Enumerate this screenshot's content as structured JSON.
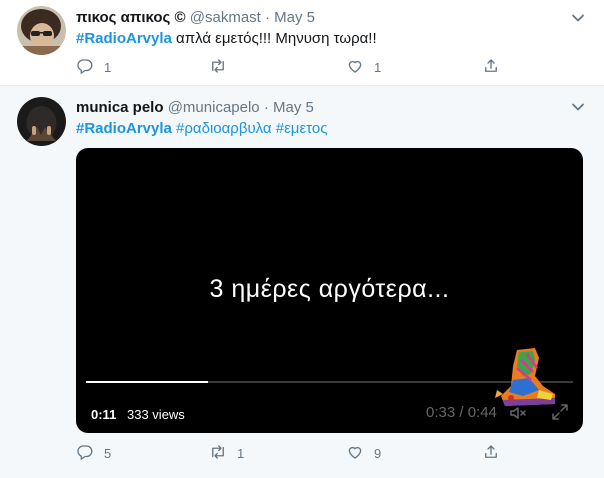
{
  "tweets": [
    {
      "name": "πικος απικος ©",
      "handle": "@sakmast",
      "date": "May 5",
      "hashtag": "#RadioArvyla",
      "text": "απλά εμετός!!! Μηνυση τωρα!!",
      "actions": {
        "reply_count": "1",
        "retweet_count": "",
        "like_count": "1"
      }
    },
    {
      "name": "munica pelo",
      "handle": "@municapelo",
      "date": "May 5",
      "hashtags": [
        "#RadioArvyla",
        "#ραδιοαρβυλα",
        "#εμετος"
      ],
      "video": {
        "caption": "3 ημέρες αργότερα...",
        "elapsed": "0:11",
        "views": "333 views",
        "duration": "0:33 / 0:44",
        "progress": 0.25
      },
      "actions": {
        "reply_count": "5",
        "retweet_count": "1",
        "like_count": "9"
      }
    }
  ],
  "icons": {
    "reply": "reply-icon",
    "retweet": "retweet-icon",
    "like": "heart-icon",
    "share": "share-icon",
    "caret": "chevron-down-icon"
  },
  "colors": {
    "link": "#1b95e0",
    "muted": "#657786",
    "text": "#14171a",
    "selected_bg": "#f5f8fa"
  }
}
